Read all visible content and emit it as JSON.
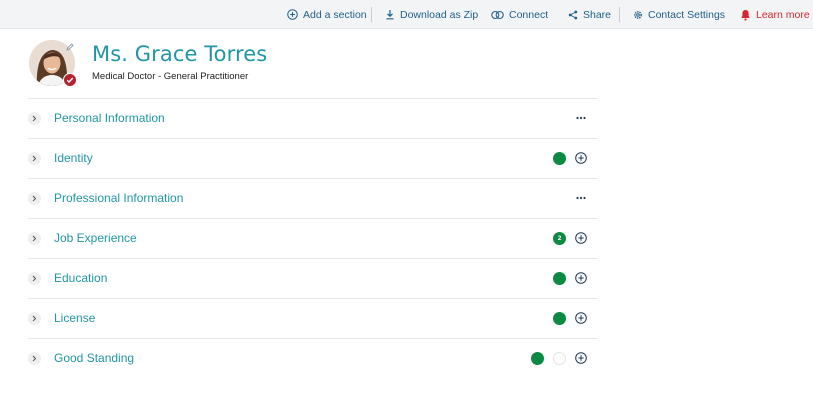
{
  "toolbar": {
    "add_section": "Add a section",
    "download_zip": "Download as Zip",
    "connect": "Connect",
    "share": "Share",
    "contact_settings": "Contact Settings",
    "learn_more": "Learn more"
  },
  "profile": {
    "name": "Ms. Grace Torres",
    "title": "Medical Doctor - General Practitioner"
  },
  "sections": [
    {
      "label": "Personal Information",
      "action": "more-menu"
    },
    {
      "label": "Identity",
      "status": [
        "complete"
      ],
      "action": "add"
    },
    {
      "label": "Professional Information",
      "action": "more-menu"
    },
    {
      "label": "Job Experience",
      "status": [
        "count"
      ],
      "count": "2",
      "action": "add"
    },
    {
      "label": "Education",
      "status": [
        "complete"
      ],
      "action": "add"
    },
    {
      "label": "License",
      "status": [
        "complete"
      ],
      "action": "add"
    },
    {
      "label": "Good Standing",
      "status": [
        "complete",
        "empty"
      ],
      "action": "add"
    }
  ],
  "colors": {
    "accent": "#2196a6",
    "link": "#1f5f8b",
    "alert": "#d6262f",
    "status_green": "#0c8a43",
    "badge_red": "#b5222e"
  }
}
